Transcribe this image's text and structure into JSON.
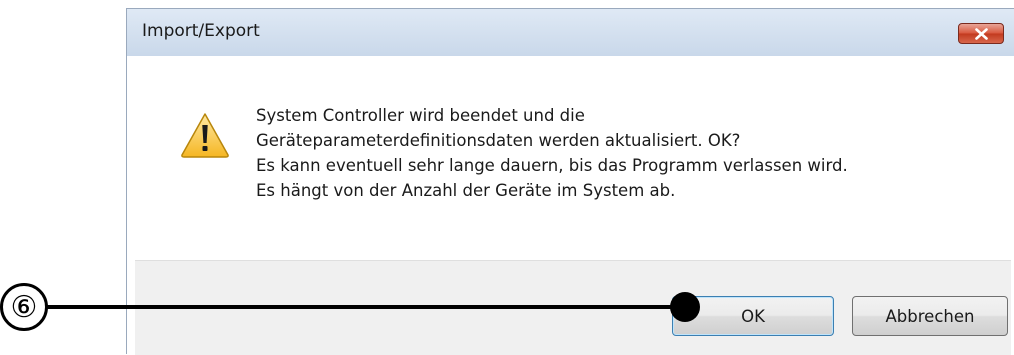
{
  "dialog": {
    "title": "Import/Export",
    "close_icon": "close-icon",
    "warning_icon": "warning-icon",
    "message_lines": [
      "System Controller wird beendet und die",
      "Geräteparameterdefinitionsdaten werden aktualisiert. OK?",
      "Es kann eventuell sehr lange dauern, bis das Programm verlassen wird.",
      "Es hängt von der Anzahl der Geräte im System ab."
    ],
    "ok_label": "OK",
    "cancel_label": "Abbrechen"
  },
  "annotation": {
    "marker": "⑥"
  },
  "colors": {
    "titlebar": "#c9d8ea",
    "close_button": "#c8432b",
    "footer": "#f0f0f0",
    "ok_focus_border": "#3c7fb1"
  }
}
